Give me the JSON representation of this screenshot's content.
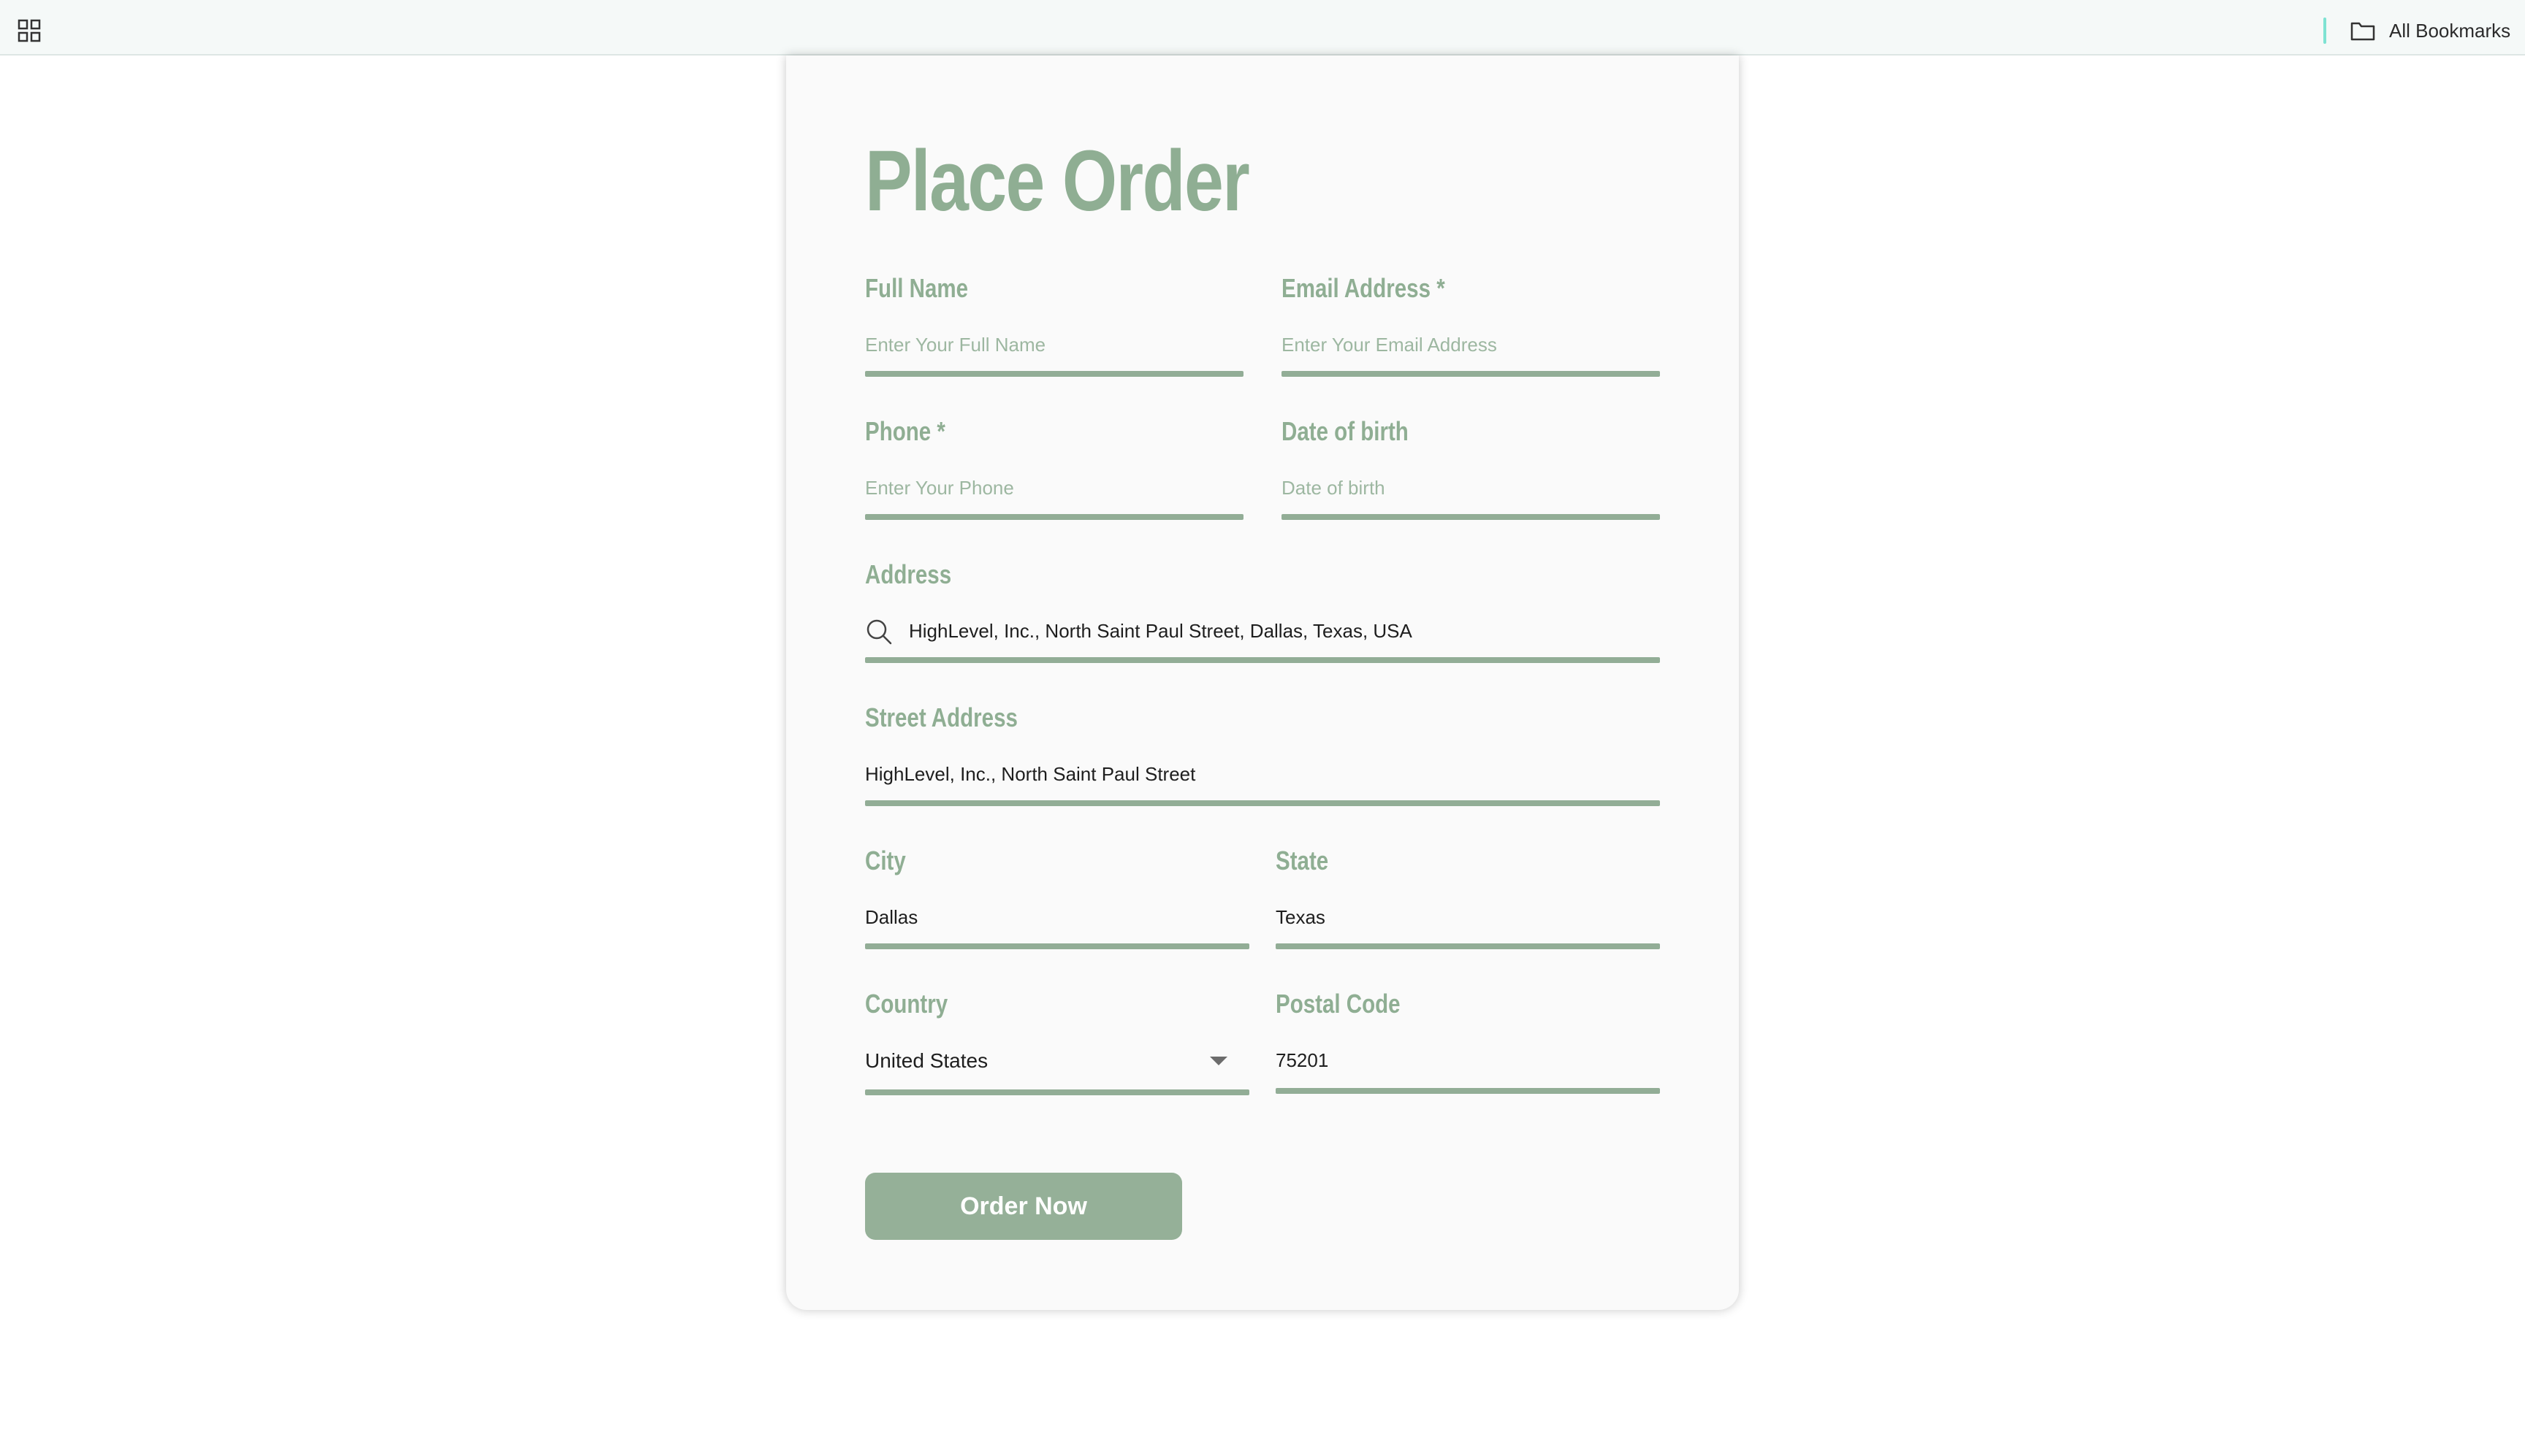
{
  "browser": {
    "bookmarks_label": "All Bookmarks"
  },
  "form": {
    "title": "Place Order",
    "full_name": {
      "label": "Full Name",
      "placeholder": "Enter Your Full Name",
      "value": ""
    },
    "email": {
      "label": "Email Address *",
      "placeholder": "Enter Your Email Address",
      "value": ""
    },
    "phone": {
      "label": "Phone *",
      "placeholder": "Enter Your Phone",
      "value": ""
    },
    "dob": {
      "label": "Date of birth",
      "placeholder": "Date of birth",
      "value": ""
    },
    "address": {
      "label": "Address",
      "value": "HighLevel, Inc., North Saint Paul Street, Dallas, Texas, USA"
    },
    "street": {
      "label": "Street Address",
      "value": "HighLevel, Inc., North Saint Paul Street"
    },
    "city": {
      "label": "City",
      "value": "Dallas"
    },
    "state": {
      "label": "State",
      "value": "Texas"
    },
    "country": {
      "label": "Country",
      "selected": "United States"
    },
    "postal": {
      "label": "Postal Code",
      "value": "75201"
    },
    "submit_label": "Order Now"
  },
  "colors": {
    "accent": "#8fae93",
    "button": "#95b098",
    "underline": "#92ad96",
    "topbar_bg": "#f5f9f8",
    "bookmark_divider": "#7ee3d3"
  },
  "icons": {
    "apps": "apps-grid-icon",
    "bookmarks": "folder-icon",
    "address_search": "search-icon",
    "country_dropdown": "caret-down-icon"
  }
}
